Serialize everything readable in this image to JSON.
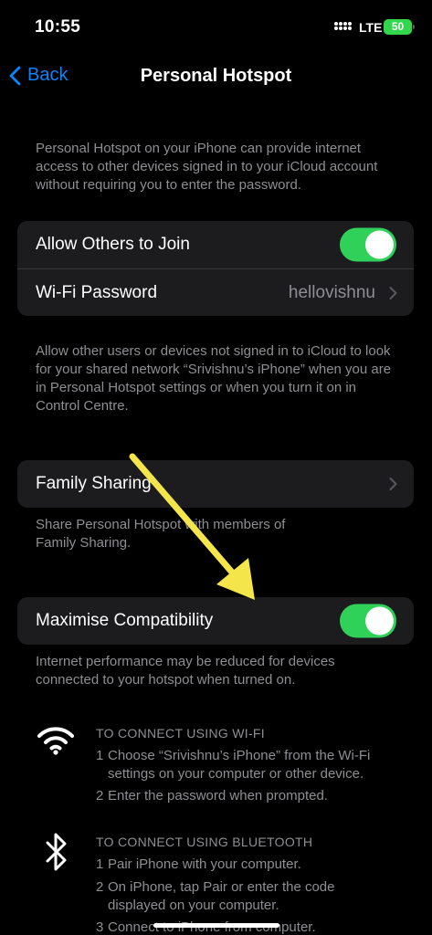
{
  "status": {
    "time": "10:55",
    "network": "LTE",
    "battery": "50"
  },
  "nav": {
    "back_label": "Back",
    "title": "Personal Hotspot"
  },
  "intro_note": "Personal Hotspot on your iPhone can provide internet access to other devices signed in to your iCloud account without requiring you to enter the password.",
  "join_group": {
    "allow_label": "Allow Others to Join",
    "allow_on": true,
    "wifi_label": "Wi-Fi Password",
    "wifi_value": "hellovishnu"
  },
  "join_note": "Allow other users or devices not signed in to iCloud to look for your shared network “Srivishnu’s iPhone” when you are in Personal Hotspot settings or when you turn it on in Control Centre.",
  "family": {
    "label": "Family Sharing",
    "note": "Share Personal Hotspot with members of Family Sharing."
  },
  "compat": {
    "label": "Maximise Compatibility",
    "on": true,
    "note": "Internet performance may be reduced for devices connected to your hotspot when turned on."
  },
  "wifi_instructions": {
    "icon": "wifi-icon",
    "heading": "TO CONNECT USING WI-FI",
    "steps": [
      {
        "num": "1",
        "text": "Choose “Srivishnu’s iPhone” from the Wi-Fi",
        "cont": "settings on your computer or other device."
      },
      {
        "num": "2",
        "text": "Enter the password when prompted."
      }
    ]
  },
  "bt_instructions": {
    "icon": "bluetooth-icon",
    "heading": "TO CONNECT USING BLUETOOTH",
    "steps": [
      {
        "num": "1",
        "text": "Pair iPhone with your computer."
      },
      {
        "num": "2",
        "text": "On iPhone, tap Pair or enter the code",
        "cont": "displayed on your computer."
      },
      {
        "num": "3",
        "text": "Connect to iPhone from computer."
      }
    ]
  },
  "colors": {
    "accent": "#0a84ff",
    "toggle_on": "#30d158",
    "annotation_arrow": "#f4e54a"
  }
}
